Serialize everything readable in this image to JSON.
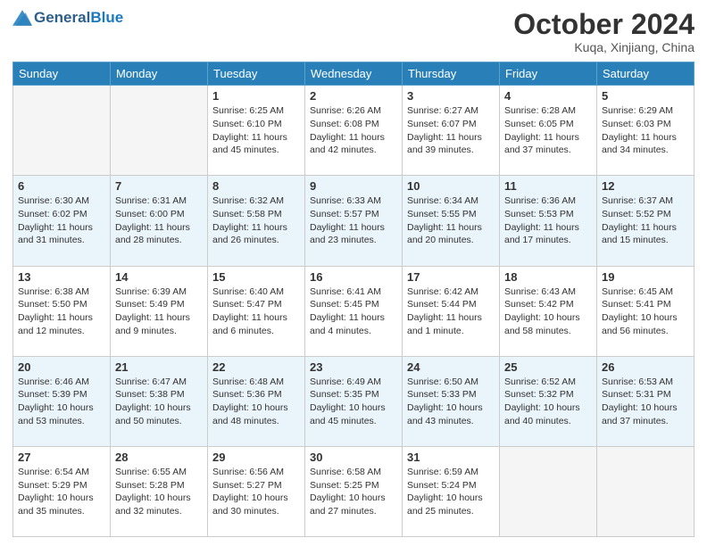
{
  "header": {
    "logo": {
      "general": "General",
      "blue": "Blue"
    },
    "title": "October 2024",
    "location": "Kuqa, Xinjiang, China"
  },
  "days_of_week": [
    "Sunday",
    "Monday",
    "Tuesday",
    "Wednesday",
    "Thursday",
    "Friday",
    "Saturday"
  ],
  "weeks": [
    [
      {
        "day": null,
        "sunrise": null,
        "sunset": null,
        "daylight": null
      },
      {
        "day": null,
        "sunrise": null,
        "sunset": null,
        "daylight": null
      },
      {
        "day": "1",
        "sunrise": "Sunrise: 6:25 AM",
        "sunset": "Sunset: 6:10 PM",
        "daylight": "Daylight: 11 hours and 45 minutes."
      },
      {
        "day": "2",
        "sunrise": "Sunrise: 6:26 AM",
        "sunset": "Sunset: 6:08 PM",
        "daylight": "Daylight: 11 hours and 42 minutes."
      },
      {
        "day": "3",
        "sunrise": "Sunrise: 6:27 AM",
        "sunset": "Sunset: 6:07 PM",
        "daylight": "Daylight: 11 hours and 39 minutes."
      },
      {
        "day": "4",
        "sunrise": "Sunrise: 6:28 AM",
        "sunset": "Sunset: 6:05 PM",
        "daylight": "Daylight: 11 hours and 37 minutes."
      },
      {
        "day": "5",
        "sunrise": "Sunrise: 6:29 AM",
        "sunset": "Sunset: 6:03 PM",
        "daylight": "Daylight: 11 hours and 34 minutes."
      }
    ],
    [
      {
        "day": "6",
        "sunrise": "Sunrise: 6:30 AM",
        "sunset": "Sunset: 6:02 PM",
        "daylight": "Daylight: 11 hours and 31 minutes."
      },
      {
        "day": "7",
        "sunrise": "Sunrise: 6:31 AM",
        "sunset": "Sunset: 6:00 PM",
        "daylight": "Daylight: 11 hours and 28 minutes."
      },
      {
        "day": "8",
        "sunrise": "Sunrise: 6:32 AM",
        "sunset": "Sunset: 5:58 PM",
        "daylight": "Daylight: 11 hours and 26 minutes."
      },
      {
        "day": "9",
        "sunrise": "Sunrise: 6:33 AM",
        "sunset": "Sunset: 5:57 PM",
        "daylight": "Daylight: 11 hours and 23 minutes."
      },
      {
        "day": "10",
        "sunrise": "Sunrise: 6:34 AM",
        "sunset": "Sunset: 5:55 PM",
        "daylight": "Daylight: 11 hours and 20 minutes."
      },
      {
        "day": "11",
        "sunrise": "Sunrise: 6:36 AM",
        "sunset": "Sunset: 5:53 PM",
        "daylight": "Daylight: 11 hours and 17 minutes."
      },
      {
        "day": "12",
        "sunrise": "Sunrise: 6:37 AM",
        "sunset": "Sunset: 5:52 PM",
        "daylight": "Daylight: 11 hours and 15 minutes."
      }
    ],
    [
      {
        "day": "13",
        "sunrise": "Sunrise: 6:38 AM",
        "sunset": "Sunset: 5:50 PM",
        "daylight": "Daylight: 11 hours and 12 minutes."
      },
      {
        "day": "14",
        "sunrise": "Sunrise: 6:39 AM",
        "sunset": "Sunset: 5:49 PM",
        "daylight": "Daylight: 11 hours and 9 minutes."
      },
      {
        "day": "15",
        "sunrise": "Sunrise: 6:40 AM",
        "sunset": "Sunset: 5:47 PM",
        "daylight": "Daylight: 11 hours and 6 minutes."
      },
      {
        "day": "16",
        "sunrise": "Sunrise: 6:41 AM",
        "sunset": "Sunset: 5:45 PM",
        "daylight": "Daylight: 11 hours and 4 minutes."
      },
      {
        "day": "17",
        "sunrise": "Sunrise: 6:42 AM",
        "sunset": "Sunset: 5:44 PM",
        "daylight": "Daylight: 11 hours and 1 minute."
      },
      {
        "day": "18",
        "sunrise": "Sunrise: 6:43 AM",
        "sunset": "Sunset: 5:42 PM",
        "daylight": "Daylight: 10 hours and 58 minutes."
      },
      {
        "day": "19",
        "sunrise": "Sunrise: 6:45 AM",
        "sunset": "Sunset: 5:41 PM",
        "daylight": "Daylight: 10 hours and 56 minutes."
      }
    ],
    [
      {
        "day": "20",
        "sunrise": "Sunrise: 6:46 AM",
        "sunset": "Sunset: 5:39 PM",
        "daylight": "Daylight: 10 hours and 53 minutes."
      },
      {
        "day": "21",
        "sunrise": "Sunrise: 6:47 AM",
        "sunset": "Sunset: 5:38 PM",
        "daylight": "Daylight: 10 hours and 50 minutes."
      },
      {
        "day": "22",
        "sunrise": "Sunrise: 6:48 AM",
        "sunset": "Sunset: 5:36 PM",
        "daylight": "Daylight: 10 hours and 48 minutes."
      },
      {
        "day": "23",
        "sunrise": "Sunrise: 6:49 AM",
        "sunset": "Sunset: 5:35 PM",
        "daylight": "Daylight: 10 hours and 45 minutes."
      },
      {
        "day": "24",
        "sunrise": "Sunrise: 6:50 AM",
        "sunset": "Sunset: 5:33 PM",
        "daylight": "Daylight: 10 hours and 43 minutes."
      },
      {
        "day": "25",
        "sunrise": "Sunrise: 6:52 AM",
        "sunset": "Sunset: 5:32 PM",
        "daylight": "Daylight: 10 hours and 40 minutes."
      },
      {
        "day": "26",
        "sunrise": "Sunrise: 6:53 AM",
        "sunset": "Sunset: 5:31 PM",
        "daylight": "Daylight: 10 hours and 37 minutes."
      }
    ],
    [
      {
        "day": "27",
        "sunrise": "Sunrise: 6:54 AM",
        "sunset": "Sunset: 5:29 PM",
        "daylight": "Daylight: 10 hours and 35 minutes."
      },
      {
        "day": "28",
        "sunrise": "Sunrise: 6:55 AM",
        "sunset": "Sunset: 5:28 PM",
        "daylight": "Daylight: 10 hours and 32 minutes."
      },
      {
        "day": "29",
        "sunrise": "Sunrise: 6:56 AM",
        "sunset": "Sunset: 5:27 PM",
        "daylight": "Daylight: 10 hours and 30 minutes."
      },
      {
        "day": "30",
        "sunrise": "Sunrise: 6:58 AM",
        "sunset": "Sunset: 5:25 PM",
        "daylight": "Daylight: 10 hours and 27 minutes."
      },
      {
        "day": "31",
        "sunrise": "Sunrise: 6:59 AM",
        "sunset": "Sunset: 5:24 PM",
        "daylight": "Daylight: 10 hours and 25 minutes."
      },
      {
        "day": null,
        "sunrise": null,
        "sunset": null,
        "daylight": null
      },
      {
        "day": null,
        "sunrise": null,
        "sunset": null,
        "daylight": null
      }
    ]
  ]
}
